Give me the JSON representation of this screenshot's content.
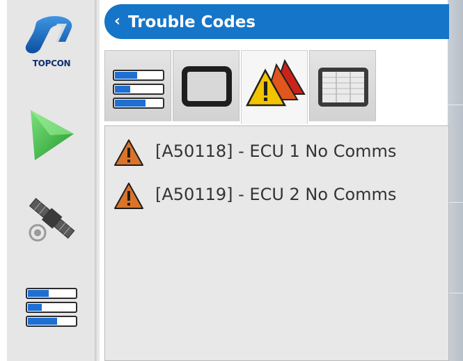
{
  "brand": {
    "logo_text": "TOPCON"
  },
  "header": {
    "title": "Trouble Codes",
    "back_glyph": "‹"
  },
  "sidebar": {
    "items": [
      {
        "icon": "play-arrow-icon"
      },
      {
        "icon": "satellite-icon"
      },
      {
        "icon": "menu-bars-icon"
      }
    ]
  },
  "tabs": [
    {
      "icon": "menu-bars-icon",
      "active": false
    },
    {
      "icon": "display-icon",
      "active": false
    },
    {
      "icon": "warning-triangles-icon",
      "active": true
    },
    {
      "icon": "data-table-icon",
      "active": false
    }
  ],
  "trouble_codes": [
    {
      "text": "[A50118] - ECU 1 No Comms",
      "icon": "warning-icon"
    },
    {
      "text": "[A50119] - ECU 2 No Comms",
      "icon": "warning-icon"
    }
  ],
  "colors": {
    "title_bar": "#1575c8",
    "warning_orange": "#d9742a",
    "play_green": "#3cba3c",
    "logo_blue": "#1a6ec0"
  }
}
